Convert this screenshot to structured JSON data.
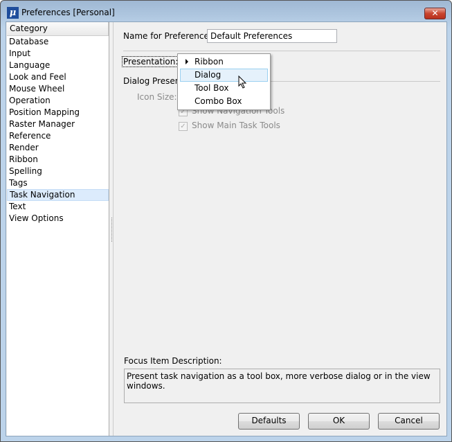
{
  "window": {
    "title": "Preferences [Personal]",
    "app_icon": "microstation-mu-icon",
    "close_icon": "close-x-icon"
  },
  "sidebar": {
    "header": "Category",
    "selected": "Task Navigation",
    "items": [
      {
        "label": "Database"
      },
      {
        "label": "Input"
      },
      {
        "label": "Language"
      },
      {
        "label": "Look and Feel"
      },
      {
        "label": "Mouse Wheel"
      },
      {
        "label": "Operation"
      },
      {
        "label": "Position Mapping"
      },
      {
        "label": "Raster Manager"
      },
      {
        "label": "Reference"
      },
      {
        "label": "Render"
      },
      {
        "label": "Ribbon"
      },
      {
        "label": "Spelling"
      },
      {
        "label": "Tags"
      },
      {
        "label": "Task Navigation"
      },
      {
        "label": "Text"
      },
      {
        "label": "View Options"
      }
    ]
  },
  "main": {
    "name_label": "Name for Preferences:",
    "name_value": "Default Preferences",
    "presentation_label": "Presentation:",
    "dropdown": {
      "options": [
        "Ribbon",
        "Dialog",
        "Tool Box",
        "Combo Box"
      ],
      "current": "Ribbon",
      "hovered": "Dialog"
    },
    "dialog_section": "Dialog Present",
    "icon_size_label": "Icon Size:",
    "show_nav_tools": {
      "label": "Show Navigation Tools",
      "checked": true,
      "enabled": false
    },
    "show_main_tools": {
      "label": "Show Main Task Tools",
      "checked": true,
      "enabled": false
    },
    "focus_label": "Focus Item Description:",
    "focus_text": "Present task navigation as a tool box, more verbose dialog or in the view windows."
  },
  "buttons": {
    "defaults": "Defaults",
    "ok": "OK",
    "cancel": "Cancel"
  }
}
